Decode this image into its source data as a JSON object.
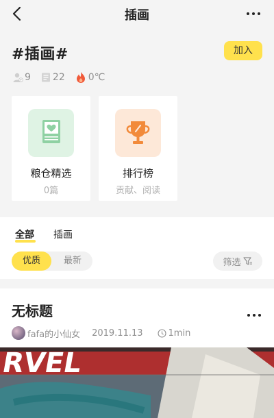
{
  "header": {
    "title": "插画"
  },
  "topic": {
    "tag_title": "#插画#",
    "join_label": "加入",
    "stats": {
      "members": "9",
      "posts": "22",
      "heat": "0℃"
    }
  },
  "cards": [
    {
      "title": "粮仓精选",
      "subtitle": "0篇"
    },
    {
      "title": "排行榜",
      "subtitle": "贡献、阅读"
    }
  ],
  "tabs": [
    {
      "label": "全部"
    },
    {
      "label": "插画"
    }
  ],
  "sort": {
    "active": "优质",
    "inactive": "最新"
  },
  "filter_label": "筛选",
  "post": {
    "title": "无标题",
    "author": "fafa的小仙女",
    "date": "2019.11.13",
    "duration": "1min",
    "cover_text": "RVEL"
  },
  "colors": {
    "accent": "#ffe14d",
    "muted": "#8f8f8f"
  }
}
